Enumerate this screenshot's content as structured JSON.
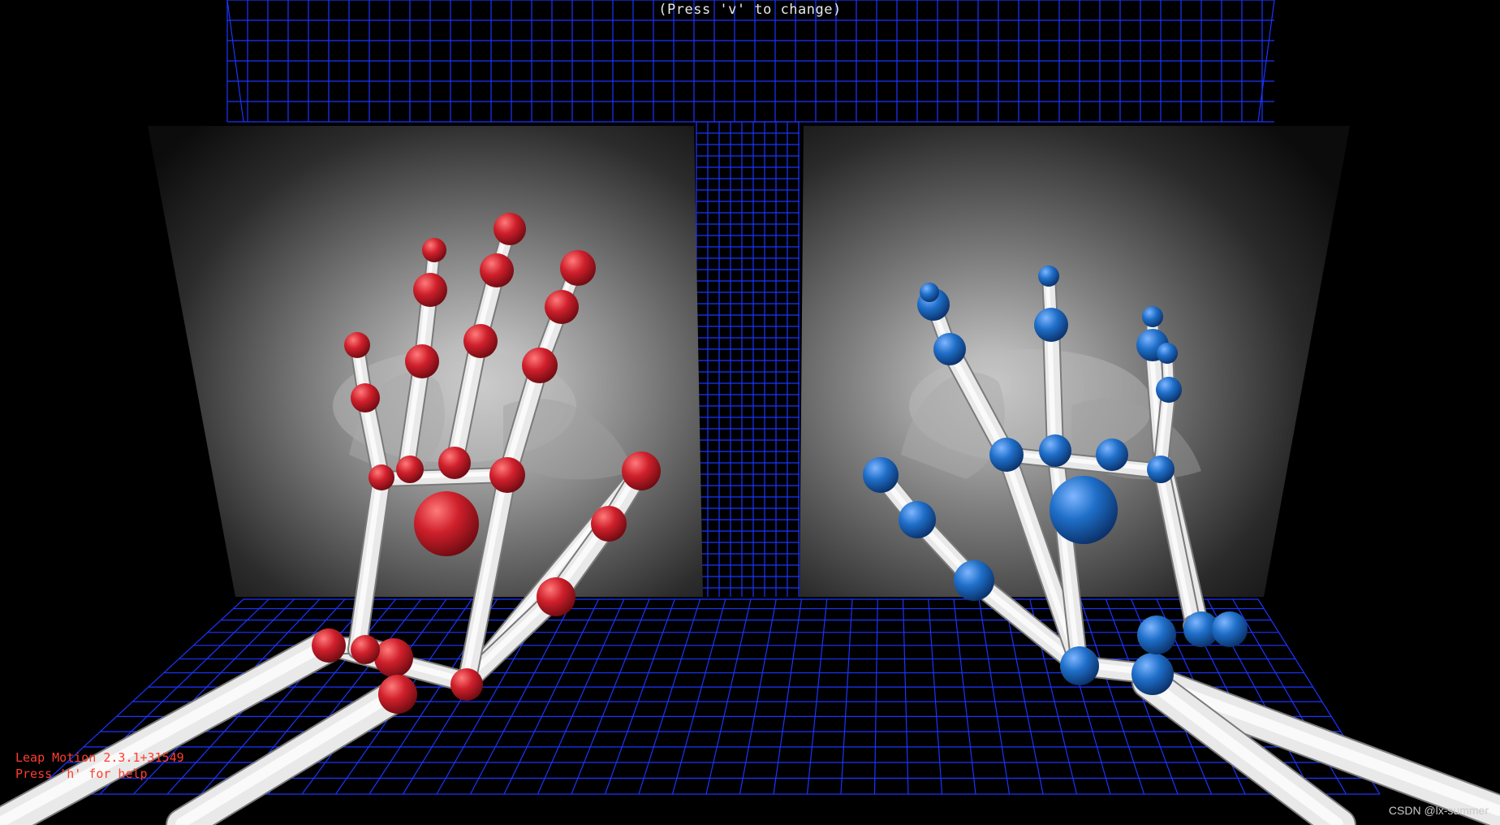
{
  "app": {
    "view_hint": "(Press 'v' to change)",
    "version": "Leap Motion 2.3.1+31549",
    "help_hint": "Press 'h' for help",
    "watermark": "CSDN @lx-summer"
  },
  "colors": {
    "background": "#000000",
    "grid": "#1b35ff",
    "left_hand_joint": "#cc1f2a",
    "right_hand_joint": "#1f6fc9",
    "bone": "#e6e6e6",
    "status_text": "#ff3d2e"
  },
  "scene": {
    "grid_floor": true,
    "grid_back_wall": true,
    "camera_feeds": [
      "left-camera-feed",
      "right-camera-feed"
    ],
    "hands": [
      "left-hand-red",
      "right-hand-blue"
    ]
  }
}
